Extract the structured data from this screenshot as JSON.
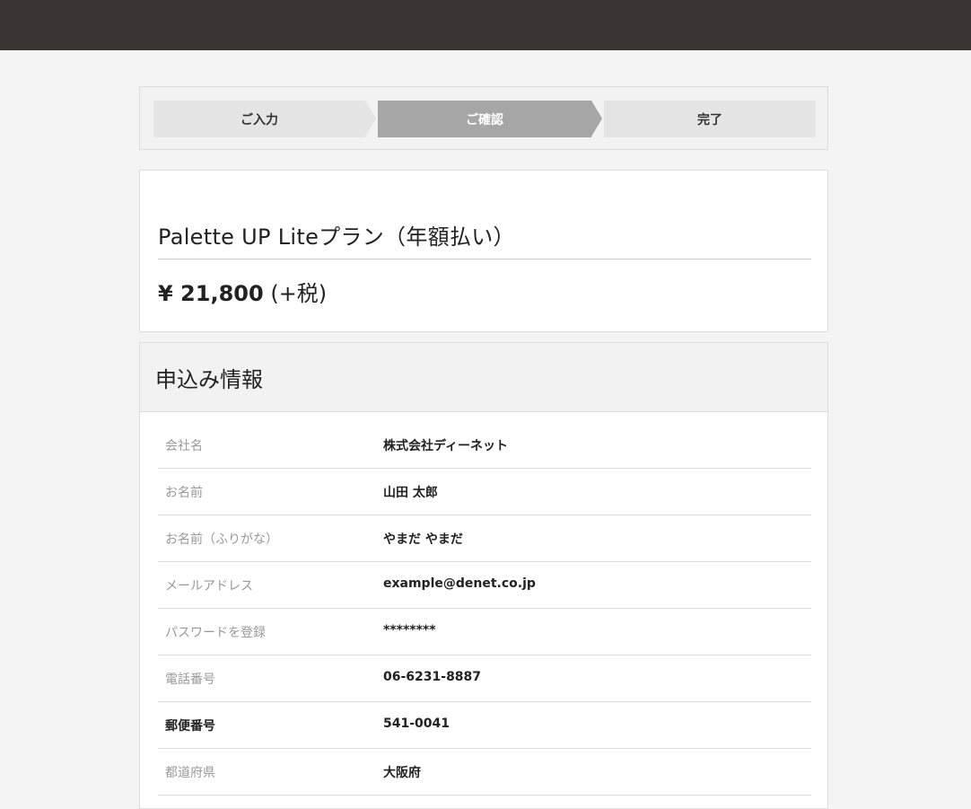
{
  "steps": [
    {
      "label": "ご入力",
      "active": false
    },
    {
      "label": "ご確認",
      "active": true
    },
    {
      "label": "完了",
      "active": false
    }
  ],
  "plan": {
    "name": "Palette UP Liteプラン（年額払い）",
    "price": "¥ 21,800",
    "tax": "(+税)"
  },
  "application": {
    "heading": "申込み情報",
    "rows": [
      {
        "label": "会社名",
        "value": "株式会社ディーネット"
      },
      {
        "label": "お名前",
        "value": "山田 太郎"
      },
      {
        "label": "お名前（ふりがな）",
        "value": "やまだ やまだ"
      },
      {
        "label": "メールアドレス",
        "value": "example@denet.co.jp"
      },
      {
        "label": "パスワードを登録",
        "value": "********"
      },
      {
        "label": "電話番号",
        "value": "06-6231-8887"
      },
      {
        "label": "郵便番号",
        "value": "541-0041"
      },
      {
        "label": "都道府県",
        "value": "大阪府"
      }
    ]
  },
  "colors": {
    "topbar": "#3a3433",
    "step_active": "#a6a6a6",
    "step_inactive": "#e5e5e5"
  }
}
